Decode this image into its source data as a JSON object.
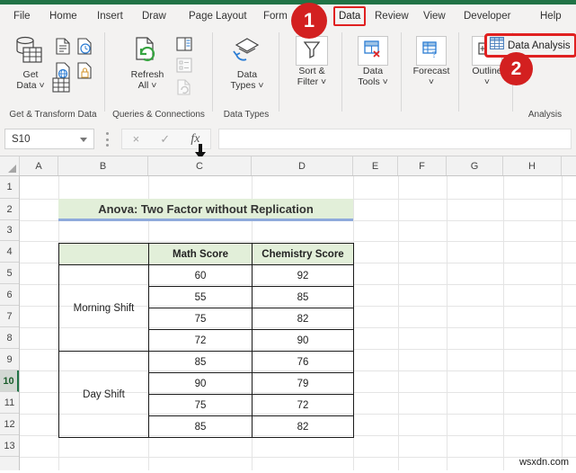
{
  "app": {
    "name": "Microsoft Excel",
    "accent_green": "#217346",
    "highlight_red": "#e02020",
    "title_fill": "#e2efd9",
    "title_underline": "#8faadc"
  },
  "ribbon": {
    "tabs": [
      {
        "label": "File",
        "active": false
      },
      {
        "label": "Home",
        "active": false
      },
      {
        "label": "Insert",
        "active": false
      },
      {
        "label": "Draw",
        "active": false
      },
      {
        "label": "Page Layout",
        "active": false
      },
      {
        "label": "Form",
        "active": false
      },
      {
        "label": "Data",
        "active": true
      },
      {
        "label": "Review",
        "active": false
      },
      {
        "label": "View",
        "active": false
      },
      {
        "label": "Developer",
        "active": false
      },
      {
        "label": "Help",
        "active": false
      }
    ],
    "groups": [
      {
        "label": "Get & Transform Data",
        "buttons": [
          {
            "caption1": "Get",
            "caption2": "Data ˅",
            "icon": "get-data-icon"
          }
        ]
      },
      {
        "label": "Queries & Connections",
        "buttons": [
          {
            "caption1": "Refresh",
            "caption2": "All ˅",
            "icon": "refresh-all-icon"
          }
        ]
      },
      {
        "label": "Data Types",
        "buttons": [
          {
            "caption1": "Data",
            "caption2": "Types ˅",
            "icon": "data-types-icon"
          }
        ]
      },
      {
        "label": "",
        "buttons": [
          {
            "caption1": "Sort &",
            "caption2": "Filter ˅",
            "icon": "sort-filter-icon"
          }
        ]
      },
      {
        "label": "",
        "buttons": [
          {
            "caption1": "Data",
            "caption2": "Tools ˅",
            "icon": "data-tools-icon"
          }
        ]
      },
      {
        "label": "",
        "buttons": [
          {
            "caption1": "Forecast",
            "caption2": "˅",
            "icon": "forecast-icon"
          }
        ]
      },
      {
        "label": "",
        "buttons": [
          {
            "caption1": "Outline",
            "caption2": "˅",
            "icon": "outline-icon"
          }
        ]
      },
      {
        "label": "Analysis",
        "buttons": [
          {
            "caption1": "Data Analysis",
            "caption2": "",
            "icon": "data-analysis-icon"
          }
        ]
      }
    ],
    "data_analysis_label": "Data Analysis",
    "analysis_group_label": "Analysis"
  },
  "callouts": [
    {
      "number": "1",
      "target": "data-tab"
    },
    {
      "number": "2",
      "target": "data-analysis-button"
    }
  ],
  "formula_bar": {
    "name_box_value": "S10",
    "cancel_icon": "×",
    "confirm_icon": "✓",
    "function_icon": "fx",
    "formula_value": ""
  },
  "grid": {
    "columns": [
      "A",
      "B",
      "C",
      "D",
      "E",
      "F",
      "G",
      "H"
    ],
    "rows": [
      "1",
      "2",
      "3",
      "4",
      "5",
      "6",
      "7",
      "8",
      "9",
      "10",
      "11",
      "12",
      "13"
    ],
    "selected_row": "10",
    "selected_column": "C"
  },
  "sheet": {
    "title": "Anova: Two Factor without Replication",
    "table": {
      "headers": [
        "",
        "Math Score",
        "Chemistry Score"
      ],
      "groups": [
        {
          "label": "Morning Shift",
          "rows": [
            {
              "math": "60",
              "chemistry": "92"
            },
            {
              "math": "55",
              "chemistry": "85"
            },
            {
              "math": "75",
              "chemistry": "82"
            },
            {
              "math": "72",
              "chemistry": "90"
            }
          ]
        },
        {
          "label": "Day Shift",
          "rows": [
            {
              "math": "85",
              "chemistry": "76"
            },
            {
              "math": "90",
              "chemistry": "79"
            },
            {
              "math": "75",
              "chemistry": "72"
            },
            {
              "math": "85",
              "chemistry": "82"
            }
          ]
        }
      ]
    }
  },
  "watermark": "wsxdn.com"
}
